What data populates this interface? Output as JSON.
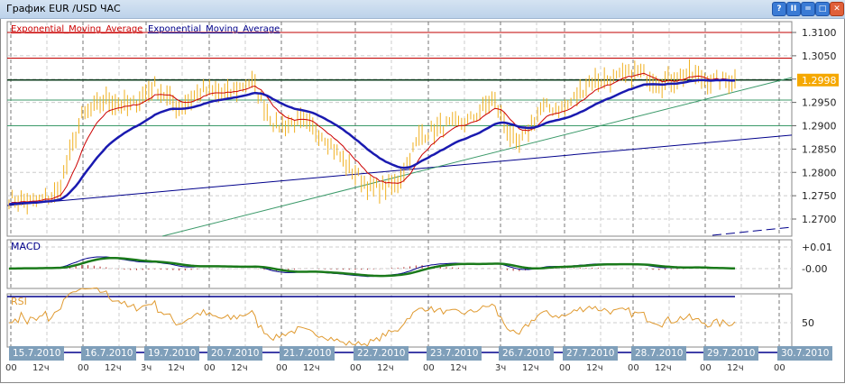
{
  "window": {
    "title": "График EUR /USD  ЧАС",
    "buttons": [
      "?",
      "pause",
      "minimize",
      "maximize",
      "close"
    ]
  },
  "legend": [
    {
      "label": "Exponential_Moving_Average",
      "color": "#cc0000"
    },
    {
      "label": "Exponential_Moving_Average",
      "color": "#00008b"
    }
  ],
  "price_axis": {
    "ticks": [
      "1.3100",
      "1.3050",
      "1.3000",
      "1.2950",
      "1.2900",
      "1.2850",
      "1.2800",
      "1.2750",
      "1.2700"
    ],
    "current": "1.2998",
    "current_color": "#f5a800"
  },
  "levels": {
    "red": [
      1.31,
      1.3045
    ],
    "dark": [
      1.2998
    ],
    "green": [
      1.2955,
      1.29
    ]
  },
  "trendlines": [
    {
      "color": "#00008b",
      "from": 1.2729,
      "to": 1.288
    },
    {
      "color": "#3c9a6a",
      "from_index": 0.2,
      "from": 1.266,
      "to": 1.3
    }
  ],
  "chart_data": {
    "type": "line",
    "series_name": "EUR/USD close (hourly, approx.)",
    "close": [
      1.2744,
      1.2735,
      1.2754,
      1.2918,
      1.2957,
      1.294,
      1.2986,
      1.2938,
      1.2976,
      1.2967,
      1.2996,
      1.2899,
      1.2909,
      1.288,
      1.2812,
      1.2764,
      1.2773,
      1.288,
      1.2899,
      1.2909,
      1.2957,
      1.2851,
      1.2938,
      1.2938,
      1.2996,
      1.3,
      1.3015,
      1.2992,
      1.3011,
      1.2996,
      1.2998
    ],
    "ylim": [
      1.268,
      1.311
    ]
  },
  "macd": {
    "label": "MACD",
    "ticks": [
      "+0.01",
      "-0.00"
    ]
  },
  "rsi": {
    "label": "RSI",
    "ticks": [
      "50"
    ]
  },
  "dates": [
    "15.7.2010",
    "16.7.2010",
    "19.7.2010",
    "20.7.2010",
    "21.7.2010",
    "22.7.2010",
    "23.7.2010",
    "26.7.2010",
    "27.7.2010",
    "28.7.2010",
    "29.7.2010",
    "30.7.2010"
  ],
  "hours": [
    [
      "00",
      "12ч"
    ],
    [
      "00",
      "12ч"
    ],
    [
      "3ч",
      "12ч"
    ],
    [
      "00",
      "12ч"
    ],
    [
      "00",
      "12ч"
    ],
    [
      "00",
      "12ч"
    ],
    [
      "00",
      "12ч"
    ],
    [
      "3ч",
      "12ч"
    ],
    [
      "00",
      "12ч"
    ],
    [
      "00",
      "12ч"
    ],
    [
      "00",
      "12ч"
    ],
    [
      "00"
    ]
  ]
}
